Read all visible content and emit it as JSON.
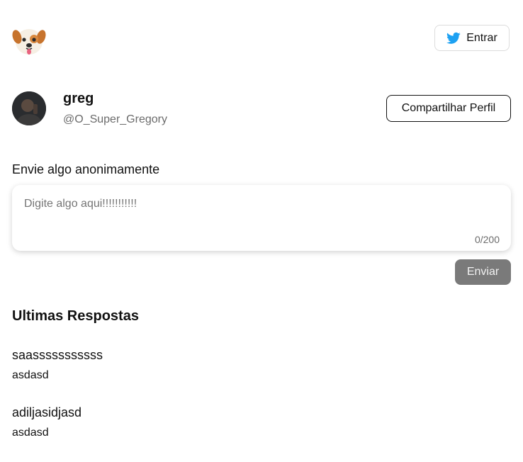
{
  "header": {
    "logo_icon": "dog-face-icon",
    "login_label": "Entrar",
    "login_icon": "twitter-bird-icon",
    "twitter_color": "#1DA1F2"
  },
  "profile": {
    "name": "greg",
    "handle": "@O_Super_Gregory",
    "share_label": "Compartilhar Perfil"
  },
  "send": {
    "title": "Envie algo anonimamente",
    "placeholder": "Digite algo aqui!!!!!!!!!!!",
    "counter": "0/200",
    "button_label": "Enviar"
  },
  "answers": {
    "title": "Ultimas Respostas",
    "items": [
      {
        "question": "saasssssssssss",
        "answer": "asdasd"
      },
      {
        "question": "adiljasidjasd",
        "answer": "asdasd"
      }
    ]
  }
}
